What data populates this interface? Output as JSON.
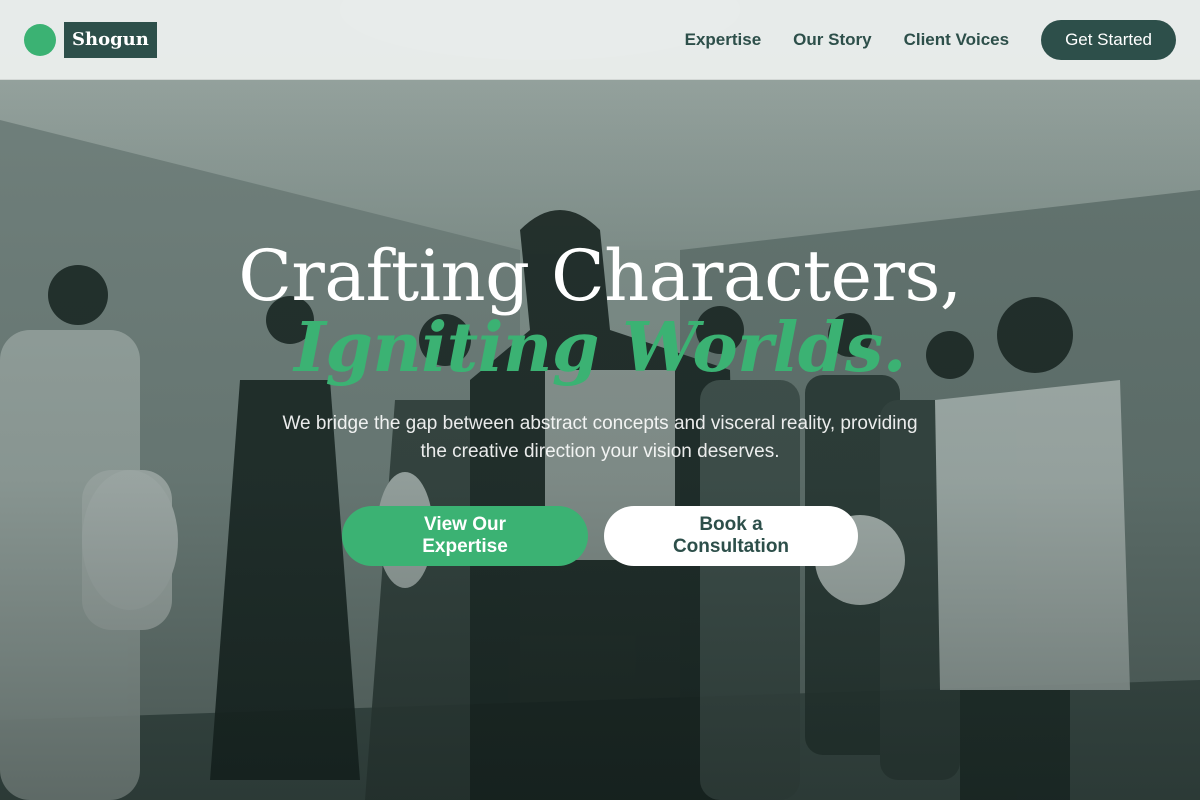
{
  "colors": {
    "brand_green": "#3bb273",
    "brand_dark": "#2d4f4a",
    "nav_bg": "#eceeed",
    "white": "#ffffff"
  },
  "nav": {
    "logo_text": "Shogun",
    "links": [
      "Expertise",
      "Our Story",
      "Client Voices"
    ],
    "cta_label": "Get Started"
  },
  "hero": {
    "headline_line1": "Crafting Characters,",
    "headline_line2": "Igniting Worlds.",
    "subtext": "We bridge the gap between abstract concepts and visceral reality, providing the creative direction your vision deserves.",
    "primary_cta": "View Our Expertise",
    "secondary_cta": "Book a Consultation",
    "background_image": "group-of-models-photo"
  }
}
